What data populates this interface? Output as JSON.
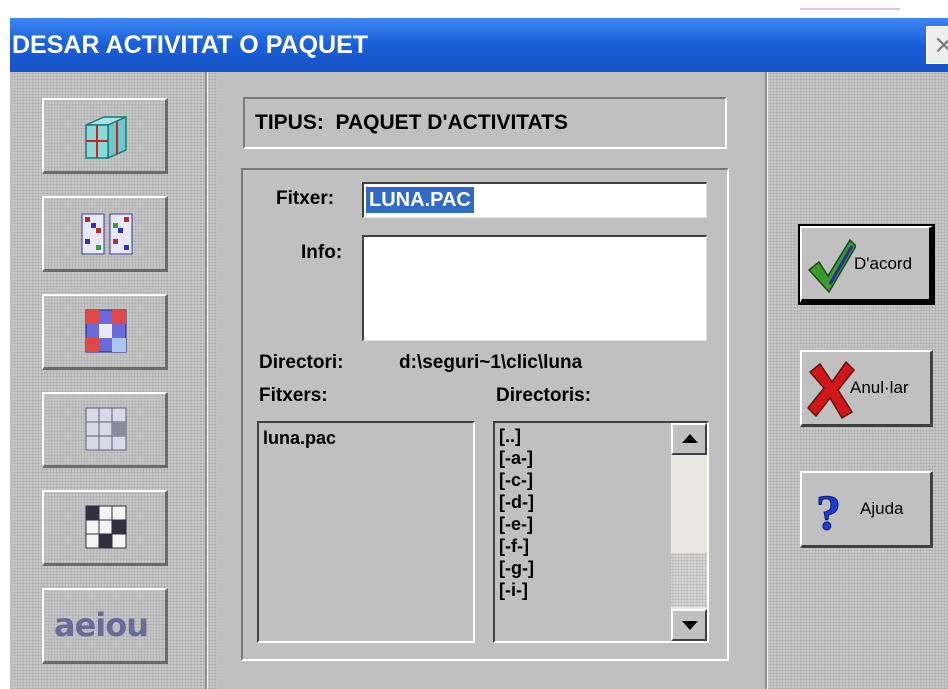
{
  "window": {
    "title": "DESAR ACTIVITAT O PAQUET",
    "close_glyph": "×"
  },
  "toolbar": {
    "buttons": [
      {
        "icon": "package-icon"
      },
      {
        "icon": "puzzle-pair-icon"
      },
      {
        "icon": "exchange-puzzle-icon"
      },
      {
        "icon": "hole-puzzle-icon"
      },
      {
        "icon": "crossword-icon"
      },
      {
        "icon": "text-activity-icon",
        "label": "aeiou"
      }
    ]
  },
  "type_box": {
    "text": "TIPUS:  PAQUET D'ACTIVITATS"
  },
  "form": {
    "file_label": "Fitxer:",
    "file_value": "LUNA.PAC",
    "info_label": "Info:",
    "info_value": "",
    "dir_label": "Directori:",
    "dir_value": "d:\\seguri~1\\clic\\luna",
    "files_label": "Fitxers:",
    "dirs_label": "Directoris:"
  },
  "files_list": [
    "luna.pac"
  ],
  "dirs_list": [
    "[..]",
    "[-a-]",
    "[-c-]",
    "[-d-]",
    "[-e-]",
    "[-f-]",
    "[-g-]",
    "[-i-]"
  ],
  "actions": {
    "ok_label": "D'acord",
    "cancel_label": "Anul·lar",
    "help_label": "Ajuda"
  },
  "colors": {
    "title_bar": "#1a5fd8",
    "selection": "#316ac5",
    "ok_check": "#3a9a2a",
    "cancel_x": "#d01818",
    "help_q": "#1a3fd0"
  }
}
